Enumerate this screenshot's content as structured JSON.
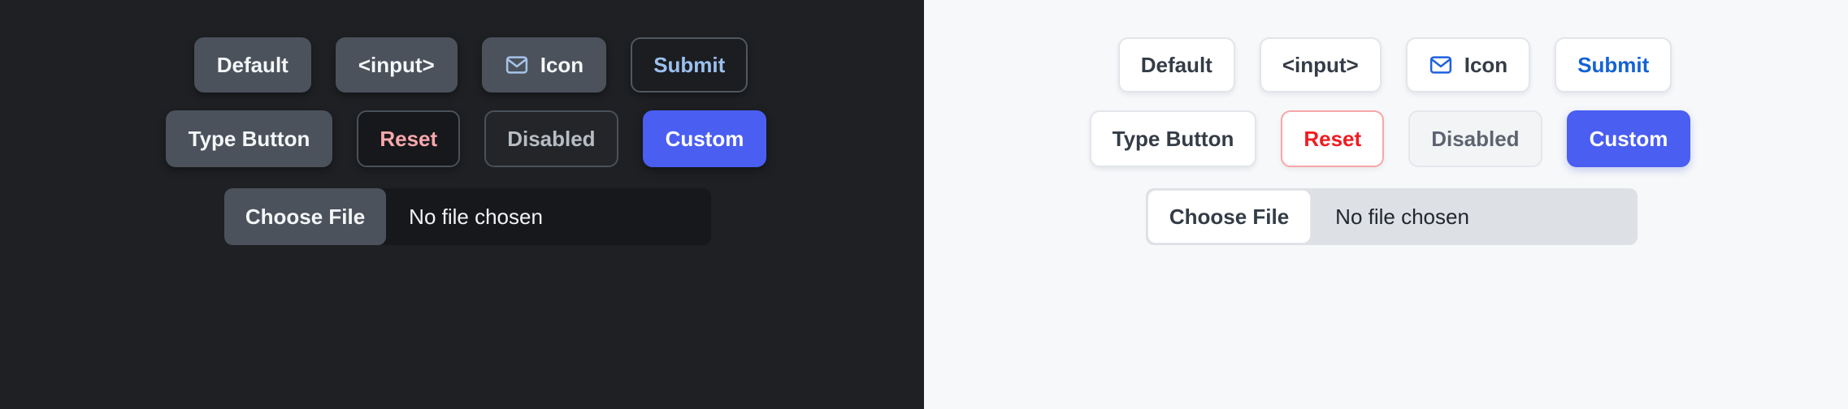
{
  "panels": [
    {
      "theme": "dark",
      "background": "#1e2024",
      "row1": [
        {
          "label": "Default",
          "name": "default-button"
        },
        {
          "label": "<input>",
          "name": "input-button"
        },
        {
          "label": "Icon",
          "name": "icon-button",
          "icon": "envelope-icon"
        },
        {
          "label": "Submit",
          "name": "submit-button"
        }
      ],
      "row2": [
        {
          "label": "Type Button",
          "name": "type-button"
        },
        {
          "label": "Reset",
          "name": "reset-button"
        },
        {
          "label": "Disabled",
          "name": "disabled-button"
        },
        {
          "label": "Custom",
          "name": "custom-button"
        }
      ],
      "file": {
        "button_label": "Choose File",
        "status": "No file chosen"
      },
      "colors": {
        "surface": "#4b525c",
        "text": "#f4f6f8",
        "submit_text": "#9cc0ef",
        "reset_text": "#f7a8ab",
        "disabled_text": "#b8bdc4",
        "custom_bg": "#4a5ef2",
        "icon_stroke": "#a6c4ea"
      }
    },
    {
      "theme": "light",
      "background": "#f7f8fa",
      "row1": [
        {
          "label": "Default",
          "name": "default-button"
        },
        {
          "label": "<input>",
          "name": "input-button"
        },
        {
          "label": "Icon",
          "name": "icon-button",
          "icon": "envelope-icon"
        },
        {
          "label": "Submit",
          "name": "submit-button"
        }
      ],
      "row2": [
        {
          "label": "Type Button",
          "name": "type-button"
        },
        {
          "label": "Reset",
          "name": "reset-button"
        },
        {
          "label": "Disabled",
          "name": "disabled-button"
        },
        {
          "label": "Custom",
          "name": "custom-button"
        }
      ],
      "file": {
        "button_label": "Choose File",
        "status": "No file chosen"
      },
      "colors": {
        "surface": "#ffffff",
        "text": "#343c47",
        "submit_text": "#1462d6",
        "reset_text": "#f01c22",
        "reset_border": "#f7a6a8",
        "disabled_text": "#5d6470",
        "custom_bg": "#4a5ef2",
        "icon_stroke": "#1f62e0",
        "file_track": "#dde0e5"
      }
    }
  ]
}
